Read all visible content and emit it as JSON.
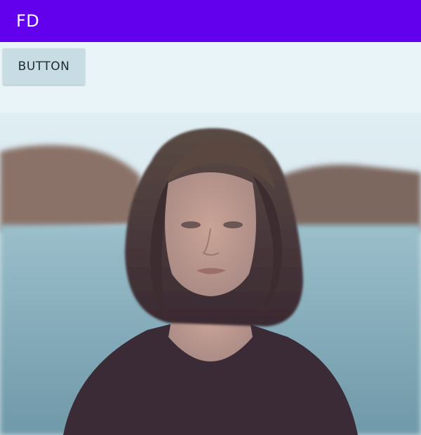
{
  "app_bar": {
    "title": "FD",
    "color": "#6200ee"
  },
  "main": {
    "button_label": "BUTTON"
  },
  "photo": {
    "subject": "portrait-photo"
  }
}
